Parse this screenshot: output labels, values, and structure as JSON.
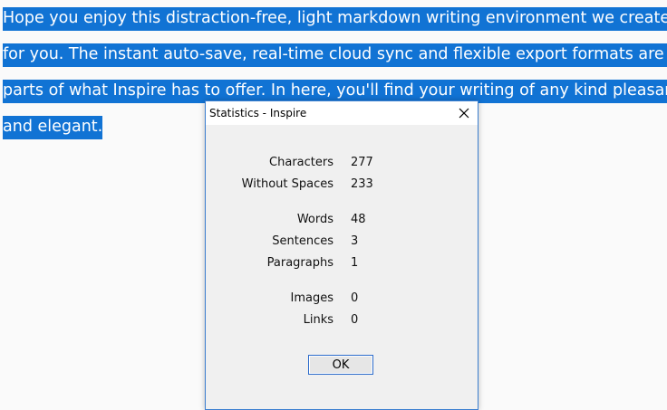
{
  "editor": {
    "lines": [
      "Hope you enjoy this distraction-free, light markdown writing environment we create",
      "for you. The instant auto-save, real-time cloud sync and flexible export formats are just",
      "parts of what Inspire has to offer. In here, you'll find your writing of any kind pleasant",
      "and elegant."
    ]
  },
  "dialog": {
    "title": "Statistics - Inspire",
    "close_icon": "close-icon",
    "stats": [
      {
        "label": "Characters",
        "value": "277"
      },
      {
        "label": "Without Spaces",
        "value": "233"
      },
      {
        "label": "Words",
        "value": "48"
      },
      {
        "label": "Sentences",
        "value": "3"
      },
      {
        "label": "Paragraphs",
        "value": "1"
      },
      {
        "label": "Images",
        "value": "0"
      },
      {
        "label": "Links",
        "value": "0"
      }
    ],
    "ok_label": "OK"
  },
  "colors": {
    "selection": "#1173d4",
    "background": "#fafafa",
    "dialog_border": "#3c7fd0",
    "dialog_bg": "#f0f0f0"
  }
}
